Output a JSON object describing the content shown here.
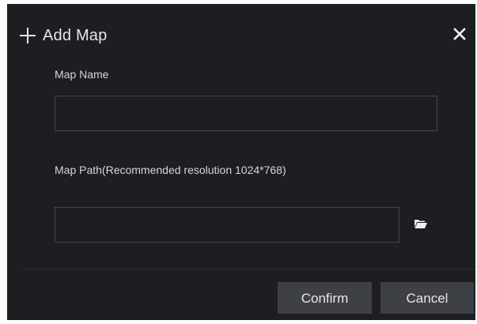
{
  "dialog": {
    "title": "Add Map",
    "map_name_label": "Map Name",
    "map_name_value": "",
    "map_path_label": "Map Path(Recommended resolution 1024*768)",
    "map_path_value": "",
    "confirm_label": "Confirm",
    "cancel_label": "Cancel"
  },
  "icons": {
    "title_icon": "plus-icon",
    "close_icon": "close-icon",
    "browse_icon": "folder-icon"
  },
  "colors": {
    "dialog_background": "#1c1e21",
    "input_border": "#44474b",
    "button_background": "#3d4044",
    "text": "#e6e6e6"
  }
}
